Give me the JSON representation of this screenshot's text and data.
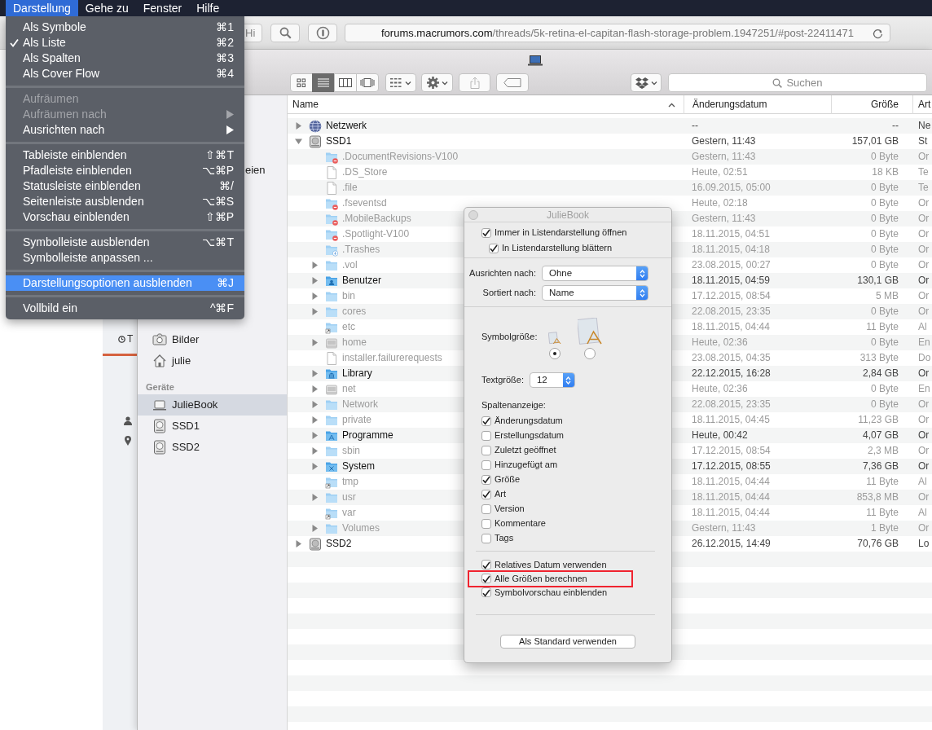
{
  "menu_bar": [
    {
      "label": "Darstellung",
      "selected": true
    },
    {
      "label": "Gehe zu",
      "selected": false
    },
    {
      "label": "Fenster",
      "selected": false
    },
    {
      "label": "Hilfe",
      "selected": false
    }
  ],
  "view_menu": {
    "groups": [
      [
        {
          "label": "Als Symbole",
          "shortcut": "⌘1",
          "checked": false,
          "disabled": false,
          "submenu": false,
          "selected": false
        },
        {
          "label": "Als Liste",
          "shortcut": "⌘2",
          "checked": true,
          "disabled": false,
          "submenu": false,
          "selected": false
        },
        {
          "label": "Als Spalten",
          "shortcut": "⌘3",
          "checked": false,
          "disabled": false,
          "submenu": false,
          "selected": false
        },
        {
          "label": "Als Cover Flow",
          "shortcut": "⌘4",
          "checked": false,
          "disabled": false,
          "submenu": false,
          "selected": false
        }
      ],
      [
        {
          "label": "Aufräumen",
          "checked": false,
          "disabled": true,
          "submenu": false,
          "selected": false
        },
        {
          "label": "Aufräumen nach",
          "checked": false,
          "disabled": true,
          "submenu": true,
          "selected": false
        },
        {
          "label": "Ausrichten nach",
          "checked": false,
          "disabled": false,
          "submenu": true,
          "selected": false
        }
      ],
      [
        {
          "label": "Tableiste einblenden",
          "shortcut": "⇧⌘T",
          "checked": false,
          "disabled": false,
          "submenu": false,
          "selected": false
        },
        {
          "label": "Pfadleiste einblenden",
          "shortcut": "⌥⌘P",
          "checked": false,
          "disabled": false,
          "submenu": false,
          "selected": false
        },
        {
          "label": "Statusleiste einblenden",
          "shortcut": "⌘/",
          "checked": false,
          "disabled": false,
          "submenu": false,
          "selected": false
        },
        {
          "label": "Seitenleiste ausblenden",
          "shortcut": "⌥⌘S",
          "checked": false,
          "disabled": false,
          "submenu": false,
          "selected": false
        },
        {
          "label": "Vorschau einblenden",
          "shortcut": "⇧⌘P",
          "checked": false,
          "disabled": false,
          "submenu": false,
          "selected": false
        }
      ],
      [
        {
          "label": "Symbolleiste ausblenden",
          "shortcut": "⌥⌘T",
          "checked": false,
          "disabled": false,
          "submenu": false,
          "selected": false
        },
        {
          "label": "Symbolleiste anpassen ...",
          "checked": false,
          "disabled": false,
          "submenu": false,
          "selected": false
        }
      ],
      [
        {
          "label": "Darstellungsoptionen ausblenden",
          "shortcut": "⌘J",
          "checked": false,
          "disabled": false,
          "submenu": false,
          "selected": true
        }
      ],
      [
        {
          "label": "Vollbild ein",
          "shortcut": "^⌘F",
          "checked": false,
          "disabled": false,
          "submenu": false,
          "selected": false
        }
      ]
    ]
  },
  "browser": {
    "button_label": "Hi",
    "address": "**forums.macrumors.com**/threads/5k-retina-el-capitan-flash-storage-problem.1947251/#post-22411471",
    "page_label": "T"
  },
  "finder": {
    "toolbar": {
      "view_modes": [
        {
          "kind": "icons",
          "selected": false
        },
        {
          "kind": "list",
          "selected": true
        },
        {
          "kind": "columns",
          "selected": false
        },
        {
          "kind": "coverflow",
          "selected": false
        }
      ],
      "actions": [
        {
          "kind": "arrange",
          "disabled": false
        },
        {
          "kind": "action",
          "disabled": false
        },
        {
          "kind": "share",
          "disabled": true
        },
        {
          "kind": "tags",
          "disabled": false
        }
      ],
      "search": {
        "placeholder": "Suchen"
      }
    },
    "sidebar": [
      {
        "items": [
          {
            "label": "eien",
            "kind": "fragment",
            "selected": false
          },
          {
            "label": "Bilder",
            "kind": "pictures",
            "selected": false
          },
          {
            "label": "julie",
            "kind": "home",
            "selected": false
          }
        ]
      },
      {
        "heading": "Geräte",
        "items": [
          {
            "label": "JulieBook",
            "kind": "laptop",
            "selected": true
          },
          {
            "label": "SSD1",
            "kind": "volume",
            "selected": false
          },
          {
            "label": "SSD2",
            "kind": "volume",
            "selected": false
          }
        ]
      }
    ],
    "columns": [
      {
        "label": "Name",
        "sorted": true
      },
      {
        "label": "Änderungsdatum",
        "sorted": false
      },
      {
        "label": "Größe",
        "sorted": false
      },
      {
        "label": "Art",
        "sorted": false
      }
    ],
    "rows": [
      {
        "name": "Netzwerk",
        "kind": "network",
        "date": "--",
        "size": "--",
        "type": "Ne",
        "dimmed": false,
        "expanded": false
      },
      {
        "name": "SSD1",
        "kind": "volume",
        "date": "Gestern, 11:43",
        "size": "157,01 GB",
        "type": "St",
        "dimmed": false,
        "expanded": true,
        "children": [
          {
            "name": ".DocumentRevisions-V100",
            "kind": "restricted_folder",
            "date": "Gestern, 11:43",
            "size": "0 Byte",
            "type": "Or",
            "dimmed": true
          },
          {
            "name": ".DS_Store",
            "kind": "file",
            "date": "Heute, 02:51",
            "size": "18 KB",
            "type": "Te",
            "dimmed": true
          },
          {
            "name": ".file",
            "kind": "file",
            "date": "16.09.2015, 05:00",
            "size": "0 Byte",
            "type": "Te",
            "dimmed": true
          },
          {
            "name": ".fseventsd",
            "kind": "restricted_folder",
            "date": "Heute, 02:18",
            "size": "0 Byte",
            "type": "Or",
            "dimmed": true
          },
          {
            "name": ".MobileBackups",
            "kind": "restricted_folder",
            "date": "Gestern, 11:43",
            "size": "0 Byte",
            "type": "Or",
            "dimmed": true
          },
          {
            "name": ".Spotlight-V100",
            "kind": "restricted_folder",
            "date": "18.11.2015, 04:51",
            "size": "0 Byte",
            "type": "Or",
            "dimmed": true
          },
          {
            "name": ".Trashes",
            "kind": "download_folder",
            "date": "18.11.2015, 04:18",
            "size": "0 Byte",
            "type": "Or",
            "dimmed": true
          },
          {
            "name": ".vol",
            "kind": "folder",
            "date": "23.08.2015, 00:27",
            "size": "0 Byte",
            "type": "Or",
            "dimmed": true,
            "expanded": false
          },
          {
            "name": "Benutzer",
            "kind": "user_folder",
            "date": "18.11.2015, 04:59",
            "size": "130,1 GB",
            "type": "Or",
            "dimmed": false,
            "expanded": false
          },
          {
            "name": "bin",
            "kind": "folder",
            "date": "17.12.2015, 08:54",
            "size": "5 MB",
            "type": "Or",
            "dimmed": true,
            "expanded": false
          },
          {
            "name": "cores",
            "kind": "folder",
            "date": "22.08.2015, 23:35",
            "size": "0 Byte",
            "type": "Or",
            "dimmed": true,
            "expanded": false
          },
          {
            "name": "etc",
            "kind": "alias_folder",
            "date": "18.11.2015, 04:44",
            "size": "11 Byte",
            "type": "Al",
            "dimmed": true
          },
          {
            "name": "home",
            "kind": "network_drive",
            "date": "Heute, 02:36",
            "size": "0 Byte",
            "type": "En",
            "dimmed": true,
            "expanded": false
          },
          {
            "name": "installer.failurerequests",
            "kind": "file",
            "date": "23.08.2015, 04:35",
            "size": "313 Byte",
            "type": "Do",
            "dimmed": true
          },
          {
            "name": "Library",
            "kind": "library_folder",
            "date": "22.12.2015, 16:28",
            "size": "2,84 GB",
            "type": "Or",
            "dimmed": false,
            "expanded": false
          },
          {
            "name": "net",
            "kind": "network_drive",
            "date": "Heute, 02:36",
            "size": "0 Byte",
            "type": "En",
            "dimmed": true,
            "expanded": false
          },
          {
            "name": "Network",
            "kind": "folder",
            "date": "22.08.2015, 23:35",
            "size": "0 Byte",
            "type": "Or",
            "dimmed": true,
            "expanded": false
          },
          {
            "name": "private",
            "kind": "folder",
            "date": "18.11.2015, 04:45",
            "size": "11,23 GB",
            "type": "Or",
            "dimmed": true,
            "expanded": false
          },
          {
            "name": "Programme",
            "kind": "apps_folder",
            "date": "Heute, 00:42",
            "size": "4,07 GB",
            "type": "Or",
            "dimmed": false,
            "expanded": false
          },
          {
            "name": "sbin",
            "kind": "folder",
            "date": "17.12.2015, 08:54",
            "size": "2,3 MB",
            "type": "Or",
            "dimmed": true,
            "expanded": false
          },
          {
            "name": "System",
            "kind": "system_folder",
            "date": "17.12.2015, 08:55",
            "size": "7,36 GB",
            "type": "Or",
            "dimmed": false,
            "expanded": false
          },
          {
            "name": "tmp",
            "kind": "alias_folder",
            "date": "18.11.2015, 04:44",
            "size": "11 Byte",
            "type": "Al",
            "dimmed": true
          },
          {
            "name": "usr",
            "kind": "folder",
            "date": "18.11.2015, 04:44",
            "size": "853,8 MB",
            "type": "Or",
            "dimmed": true,
            "expanded": false
          },
          {
            "name": "var",
            "kind": "alias_folder",
            "date": "18.11.2015, 04:44",
            "size": "11 Byte",
            "type": "Al",
            "dimmed": true
          },
          {
            "name": "Volumes",
            "kind": "folder",
            "date": "Gestern, 11:43",
            "size": "1 Byte",
            "type": "Or",
            "dimmed": true,
            "expanded": false
          }
        ]
      },
      {
        "name": "SSD2",
        "kind": "volume",
        "date": "26.12.2015, 14:49",
        "size": "70,76 GB",
        "type": "Lo",
        "dimmed": false,
        "expanded": false
      }
    ]
  },
  "view_options": {
    "title": "JulieBook",
    "options_top": [
      {
        "label": "Immer in Listendarstellung öffnen",
        "checked": true,
        "children": [
          {
            "label": "In Listendarstellung blättern",
            "checked": true
          }
        ]
      }
    ],
    "selects": [
      {
        "label": "Ausrichten nach:",
        "value": "Ohne"
      },
      {
        "label": "Sortiert nach:",
        "value": "Name"
      }
    ],
    "icon_size": {
      "label": "Symbolgröße:",
      "options": [
        {
          "selected": true
        },
        {
          "selected": false
        }
      ]
    },
    "text_size": {
      "label": "Textgröße:",
      "value": "12"
    },
    "columns": {
      "heading": "Spaltenanzeige:",
      "items": [
        {
          "label": "Änderungsdatum",
          "checked": true
        },
        {
          "label": "Erstellungsdatum",
          "checked": false
        },
        {
          "label": "Zuletzt geöffnet",
          "checked": false
        },
        {
          "label": "Hinzugefügt am",
          "checked": false
        },
        {
          "label": "Größe",
          "checked": true
        },
        {
          "label": "Art",
          "checked": true
        },
        {
          "label": "Version",
          "checked": false
        },
        {
          "label": "Kommentare",
          "checked": false
        },
        {
          "label": "Tags",
          "checked": false
        }
      ]
    },
    "options_bottom": [
      {
        "label": "Relatives Datum verwenden",
        "checked": true,
        "highlighted": false
      },
      {
        "label": "Alle Größen berechnen",
        "checked": true,
        "highlighted": true
      },
      {
        "label": "Symbolvorschau einblenden",
        "checked": true,
        "highlighted": false
      }
    ],
    "button": "Als Standard verwenden"
  }
}
